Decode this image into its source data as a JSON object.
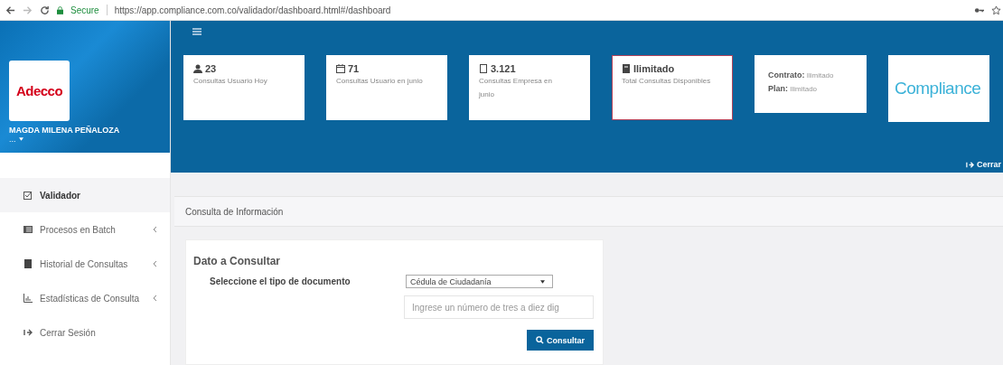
{
  "browser": {
    "secure_label": "Secure",
    "url": "https://app.compliance.com.co/validador/dashboard.html#/dashboard"
  },
  "sidebar": {
    "logo": "Adecco",
    "user": "MAGDA MILENA PEÑALOZA",
    "user_more": "...",
    "items": [
      {
        "label": "Validador",
        "selected": true,
        "submenu": false
      },
      {
        "label": "Procesos en Batch",
        "selected": false,
        "submenu": true
      },
      {
        "label": "Historial de Consultas",
        "selected": false,
        "submenu": true
      },
      {
        "label": "Estadísticas de Consulta",
        "selected": false,
        "submenu": true
      },
      {
        "label": "Cerrar Sesión",
        "selected": false,
        "submenu": false
      }
    ]
  },
  "header": {
    "cards": [
      {
        "kind": "stat",
        "value": "23",
        "label": "Consultas Usuario Hoy",
        "highlighted": false
      },
      {
        "kind": "stat",
        "value": "71",
        "label": "Consultas Usuario en junio",
        "highlighted": false
      },
      {
        "kind": "stat",
        "value": "3.121",
        "label": "Consultas Empresa en junio",
        "highlighted": false
      },
      {
        "kind": "stat",
        "value": "Ilimitado",
        "label": "Total Consultas Disponibles",
        "highlighted": true
      },
      {
        "kind": "contract",
        "lines": [
          {
            "key": "Contrato:",
            "value": "Ilimitado"
          },
          {
            "key": "Plan:",
            "value": "Ilimitado"
          }
        ],
        "highlighted": false
      },
      {
        "kind": "logo",
        "text": "Compliance",
        "highlighted": false
      }
    ],
    "logout": "Cerrar"
  },
  "panel": {
    "title": "Consulta de Información",
    "heading": "Dato a Consultar",
    "doc_label": "Seleccione el tipo de documento",
    "doc_type": "Cédula de Ciudadanía",
    "number_placeholder": "Ingrese un número de tres a diez dig",
    "button": "Consultar"
  }
}
